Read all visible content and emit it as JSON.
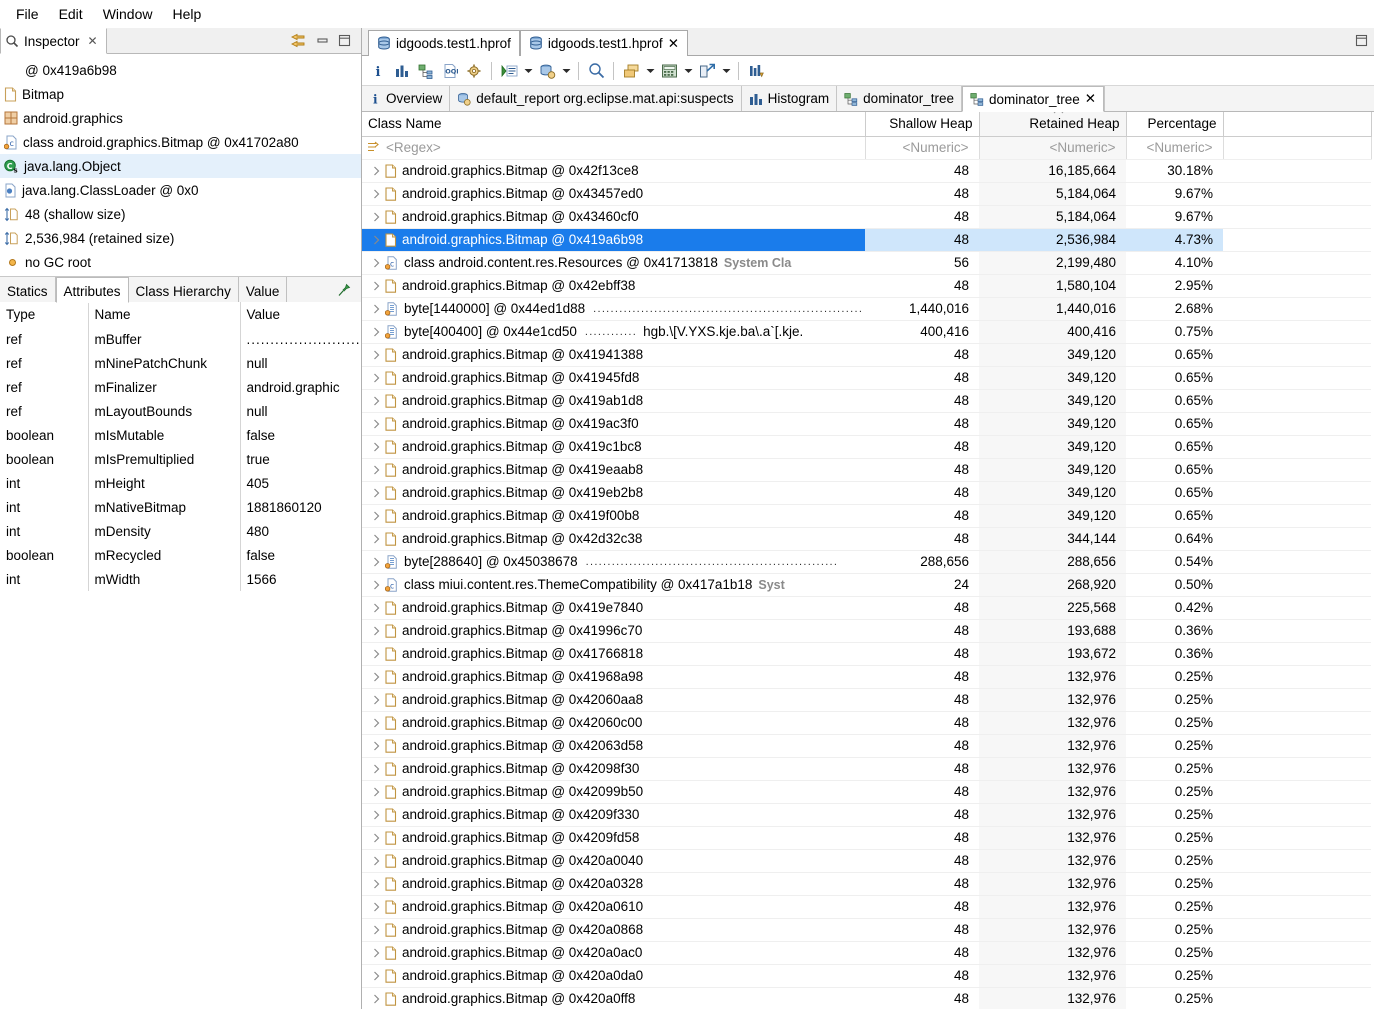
{
  "menubar": {
    "items": [
      {
        "label": "File"
      },
      {
        "label": "Edit"
      },
      {
        "label": "Window"
      },
      {
        "label": "Help"
      }
    ]
  },
  "inspector": {
    "tab_label": "Inspector",
    "tab_close": "✕",
    "tools": [
      {
        "name": "link-with-editor-icon"
      },
      {
        "name": "minimize-icon"
      },
      {
        "name": "maximize-icon"
      }
    ],
    "rows": [
      {
        "icon": "at-icon",
        "label": "@ 0x419a6b98",
        "selected": false
      },
      {
        "icon": "object-icon",
        "label": "Bitmap",
        "selected": false
      },
      {
        "icon": "package-icon",
        "label": "android.graphics",
        "selected": false
      },
      {
        "icon": "class-icon",
        "label": "class android.graphics.Bitmap @ 0x41702a80",
        "selected": false
      },
      {
        "icon": "superclass-icon",
        "label": "java.lang.Object",
        "selected": true
      },
      {
        "icon": "classloader-icon",
        "label": "java.lang.ClassLoader @ 0x0",
        "selected": false
      },
      {
        "icon": "shallow-size-icon",
        "label": "48 (shallow size)",
        "selected": false
      },
      {
        "icon": "retained-size-icon",
        "label": "2,536,984 (retained size)",
        "selected": false
      },
      {
        "icon": "gcroot-icon",
        "label": "no GC root",
        "selected": false
      }
    ],
    "tabs": [
      {
        "label": "Statics",
        "active": false
      },
      {
        "label": "Attributes",
        "active": true
      },
      {
        "label": "Class Hierarchy",
        "active": false
      },
      {
        "label": "Value",
        "active": false
      }
    ],
    "pin_icon": "pin-icon",
    "attributes": {
      "columns": [
        "Type",
        "Name",
        "Value"
      ],
      "rows": [
        {
          "type": "ref",
          "name": "mBuffer",
          "value": "......................................"
        },
        {
          "type": "ref",
          "name": "mNinePatchChunk",
          "value": "null"
        },
        {
          "type": "ref",
          "name": "mFinalizer",
          "value": "android.graphic"
        },
        {
          "type": "ref",
          "name": "mLayoutBounds",
          "value": "null"
        },
        {
          "type": "boolean",
          "name": "mIsMutable",
          "value": "false"
        },
        {
          "type": "boolean",
          "name": "mIsPremultiplied",
          "value": "true"
        },
        {
          "type": "int",
          "name": "mHeight",
          "value": "405"
        },
        {
          "type": "int",
          "name": "mNativeBitmap",
          "value": "1881860120"
        },
        {
          "type": "int",
          "name": "mDensity",
          "value": "480"
        },
        {
          "type": "boolean",
          "name": "mRecycled",
          "value": "false"
        },
        {
          "type": "int",
          "name": "mWidth",
          "value": "1566"
        }
      ]
    }
  },
  "editor": {
    "tabs": [
      {
        "label": "idgoods.test1.hprof",
        "icon": "heapdump-icon",
        "active": false,
        "closable": false
      },
      {
        "label": "idgoods.test1.hprof",
        "icon": "heapdump-icon",
        "active": true,
        "closable": true,
        "close": "✕"
      }
    ],
    "maximize_icon": "maximize-icon",
    "toolbar": [
      {
        "name": "info-icon",
        "arrow": false
      },
      {
        "name": "histogram-icon",
        "arrow": false
      },
      {
        "name": "dominator-tree-icon",
        "arrow": false
      },
      {
        "name": "oql-icon",
        "arrow": false
      },
      {
        "name": "inspect-gear-icon",
        "arrow": false
      },
      {
        "sep": true
      },
      {
        "name": "run-expert-system-icon",
        "arrow": true
      },
      {
        "name": "query-browser-icon",
        "arrow": true
      },
      {
        "sep": true
      },
      {
        "name": "search-icon",
        "arrow": false
      },
      {
        "sep": true
      },
      {
        "name": "group-by-icon",
        "arrow": true
      },
      {
        "name": "calculator-icon",
        "arrow": true
      },
      {
        "name": "export-icon",
        "arrow": true
      },
      {
        "sep": true
      },
      {
        "name": "compare-icon",
        "arrow": false
      }
    ],
    "inner_tabs": [
      {
        "label": "Overview",
        "icon": "info-icon",
        "active": false
      },
      {
        "label": "default_report org.eclipse.mat.api:suspects",
        "icon": "report-icon",
        "active": false
      },
      {
        "label": "Histogram",
        "icon": "histogram-icon",
        "active": false
      },
      {
        "label": "dominator_tree",
        "icon": "dominator-tree-icon",
        "active": false
      },
      {
        "label": "dominator_tree",
        "icon": "dominator-tree-icon",
        "active": true,
        "close": "✕"
      }
    ]
  },
  "table": {
    "columns": [
      {
        "label": "Class Name",
        "align": "left",
        "sorted": false
      },
      {
        "label": "Shallow Heap",
        "align": "right",
        "sorted": false
      },
      {
        "label": "Retained Heap",
        "align": "right",
        "sorted": true
      },
      {
        "label": "Percentage",
        "align": "right",
        "sorted": false
      }
    ],
    "filter_row": {
      "class_name": "<Regex>",
      "shallow": "<Numeric>",
      "retained": "<Numeric>",
      "percentage": "<Numeric>"
    },
    "rows": [
      {
        "icon": "object-icon",
        "name": "android.graphics.Bitmap @ 0x42f13ce8",
        "shallow": "48",
        "retained": "16,185,664",
        "pct": "30.18%"
      },
      {
        "icon": "object-icon",
        "name": "android.graphics.Bitmap @ 0x43457ed0",
        "shallow": "48",
        "retained": "5,184,064",
        "pct": "9.67%"
      },
      {
        "icon": "object-icon",
        "name": "android.graphics.Bitmap @ 0x43460cf0",
        "shallow": "48",
        "retained": "5,184,064",
        "pct": "9.67%"
      },
      {
        "icon": "object-icon",
        "name": "android.graphics.Bitmap @ 0x419a6b98",
        "shallow": "48",
        "retained": "2,536,984",
        "pct": "4.73%",
        "selected": true
      },
      {
        "icon": "class-icon",
        "name": "class android.content.res.Resources @ 0x41713818",
        "suffix": "System Cla",
        "shallow": "56",
        "retained": "2,199,480",
        "pct": "4.10%"
      },
      {
        "icon": "object-icon",
        "name": "android.graphics.Bitmap @ 0x42ebff38",
        "shallow": "48",
        "retained": "1,580,104",
        "pct": "2.95%"
      },
      {
        "icon": "array-icon",
        "name": "byte[1440000] @ 0x44ed1d88",
        "dots": "..............................................................",
        "shallow": "1,440,016",
        "retained": "1,440,016",
        "pct": "2.68%"
      },
      {
        "icon": "array-icon",
        "name": "byte[400400] @ 0x44e1cd50",
        "dots": "............",
        "arrtext": "hgb.\\[V.YXS.kje.ba\\.a`[.kje.",
        "shallow": "400,416",
        "retained": "400,416",
        "pct": "0.75%"
      },
      {
        "icon": "object-icon",
        "name": "android.graphics.Bitmap @ 0x41941388",
        "shallow": "48",
        "retained": "349,120",
        "pct": "0.65%"
      },
      {
        "icon": "object-icon",
        "name": "android.graphics.Bitmap @ 0x41945fd8",
        "shallow": "48",
        "retained": "349,120",
        "pct": "0.65%"
      },
      {
        "icon": "object-icon",
        "name": "android.graphics.Bitmap @ 0x419ab1d8",
        "shallow": "48",
        "retained": "349,120",
        "pct": "0.65%"
      },
      {
        "icon": "object-icon",
        "name": "android.graphics.Bitmap @ 0x419ac3f0",
        "shallow": "48",
        "retained": "349,120",
        "pct": "0.65%"
      },
      {
        "icon": "object-icon",
        "name": "android.graphics.Bitmap @ 0x419c1bc8",
        "shallow": "48",
        "retained": "349,120",
        "pct": "0.65%"
      },
      {
        "icon": "object-icon",
        "name": "android.graphics.Bitmap @ 0x419eaab8",
        "shallow": "48",
        "retained": "349,120",
        "pct": "0.65%"
      },
      {
        "icon": "object-icon",
        "name": "android.graphics.Bitmap @ 0x419eb2b8",
        "shallow": "48",
        "retained": "349,120",
        "pct": "0.65%"
      },
      {
        "icon": "object-icon",
        "name": "android.graphics.Bitmap @ 0x419f00b8",
        "shallow": "48",
        "retained": "349,120",
        "pct": "0.65%"
      },
      {
        "icon": "object-icon",
        "name": "android.graphics.Bitmap @ 0x42d32c38",
        "shallow": "48",
        "retained": "344,144",
        "pct": "0.64%"
      },
      {
        "icon": "array-icon",
        "name": "byte[288640] @ 0x45038678",
        "dots": "..........................................................",
        "shallow": "288,656",
        "retained": "288,656",
        "pct": "0.54%"
      },
      {
        "icon": "class-icon",
        "name": "class miui.content.res.ThemeCompatibility @ 0x417a1b18",
        "suffix": "Syst",
        "shallow": "24",
        "retained": "268,920",
        "pct": "0.50%"
      },
      {
        "icon": "object-icon",
        "name": "android.graphics.Bitmap @ 0x419e7840",
        "shallow": "48",
        "retained": "225,568",
        "pct": "0.42%"
      },
      {
        "icon": "object-icon",
        "name": "android.graphics.Bitmap @ 0x41996c70",
        "shallow": "48",
        "retained": "193,688",
        "pct": "0.36%"
      },
      {
        "icon": "object-icon",
        "name": "android.graphics.Bitmap @ 0x41766818",
        "shallow": "48",
        "retained": "193,672",
        "pct": "0.36%"
      },
      {
        "icon": "object-icon",
        "name": "android.graphics.Bitmap @ 0x41968a98",
        "shallow": "48",
        "retained": "132,976",
        "pct": "0.25%"
      },
      {
        "icon": "object-icon",
        "name": "android.graphics.Bitmap @ 0x42060aa8",
        "shallow": "48",
        "retained": "132,976",
        "pct": "0.25%"
      },
      {
        "icon": "object-icon",
        "name": "android.graphics.Bitmap @ 0x42060c00",
        "shallow": "48",
        "retained": "132,976",
        "pct": "0.25%"
      },
      {
        "icon": "object-icon",
        "name": "android.graphics.Bitmap @ 0x42063d58",
        "shallow": "48",
        "retained": "132,976",
        "pct": "0.25%"
      },
      {
        "icon": "object-icon",
        "name": "android.graphics.Bitmap @ 0x42098f30",
        "shallow": "48",
        "retained": "132,976",
        "pct": "0.25%"
      },
      {
        "icon": "object-icon",
        "name": "android.graphics.Bitmap @ 0x42099b50",
        "shallow": "48",
        "retained": "132,976",
        "pct": "0.25%"
      },
      {
        "icon": "object-icon",
        "name": "android.graphics.Bitmap @ 0x4209f330",
        "shallow": "48",
        "retained": "132,976",
        "pct": "0.25%"
      },
      {
        "icon": "object-icon",
        "name": "android.graphics.Bitmap @ 0x4209fd58",
        "shallow": "48",
        "retained": "132,976",
        "pct": "0.25%"
      },
      {
        "icon": "object-icon",
        "name": "android.graphics.Bitmap @ 0x420a0040",
        "shallow": "48",
        "retained": "132,976",
        "pct": "0.25%"
      },
      {
        "icon": "object-icon",
        "name": "android.graphics.Bitmap @ 0x420a0328",
        "shallow": "48",
        "retained": "132,976",
        "pct": "0.25%"
      },
      {
        "icon": "object-icon",
        "name": "android.graphics.Bitmap @ 0x420a0610",
        "shallow": "48",
        "retained": "132,976",
        "pct": "0.25%"
      },
      {
        "icon": "object-icon",
        "name": "android.graphics.Bitmap @ 0x420a0868",
        "shallow": "48",
        "retained": "132,976",
        "pct": "0.25%"
      },
      {
        "icon": "object-icon",
        "name": "android.graphics.Bitmap @ 0x420a0ac0",
        "shallow": "48",
        "retained": "132,976",
        "pct": "0.25%"
      },
      {
        "icon": "object-icon",
        "name": "android.graphics.Bitmap @ 0x420a0da0",
        "shallow": "48",
        "retained": "132,976",
        "pct": "0.25%"
      },
      {
        "icon": "object-icon",
        "name": "android.graphics.Bitmap @ 0x420a0ff8",
        "shallow": "48",
        "retained": "132,976",
        "pct": "0.25%"
      }
    ]
  },
  "colors": {
    "selection_blue": "#1a7ceb",
    "selection_light": "#cfe6fb",
    "inspector_selection": "#e4f0fb",
    "sorted_column": "#f7f7f7"
  }
}
